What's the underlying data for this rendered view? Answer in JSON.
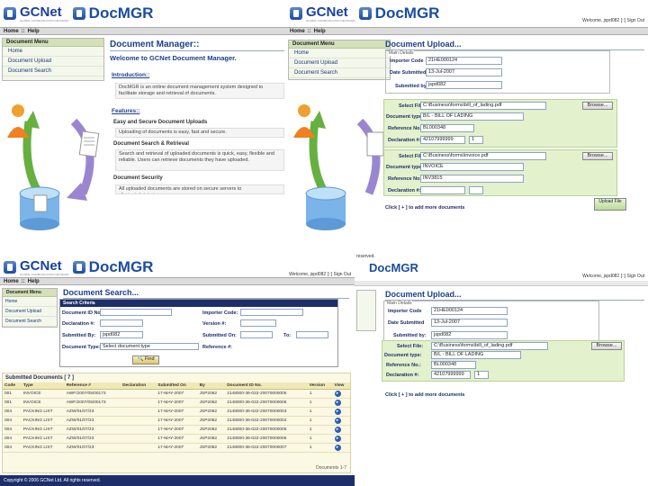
{
  "header": {
    "brand": "GCNet",
    "brand_sub": "GLOBAL COMMUNICATION NETWORK",
    "product": "DocMGR"
  },
  "nav": {
    "home": "Home",
    "sep": "::",
    "help": "Help"
  },
  "welcome_text": "Welcome, jspd082 [::] Sign Out",
  "sidebar": {
    "title": "Document Menu",
    "items": [
      "Home",
      "Document Upload",
      "Document Search"
    ]
  },
  "manager": {
    "title": "Document Manager::",
    "welcome": "Welcome to GCNet Document Manager.",
    "intro_heading": "Introduction::",
    "intro_text": "DocMGR is an online document management system designed to facilitate storage and retrieval of documents.",
    "features_heading": "Features::",
    "f1_title": "Easy and Secure Document Uploads",
    "f1_text": "Uploading of documents is easy, fast and secure.",
    "f2_title": "Document Search & Retrieval",
    "f2_text": "Search and retrieval of uploaded documents is quick, easy, flexible and reliable. Users can retrieve documents they have uploaded.",
    "f3_title": "Document Security",
    "f3_text": "All uploaded documents are stored on secure servers to eliminate/minimize"
  },
  "upload1": {
    "title": "Document Upload...",
    "main_details": "Main Details",
    "importer_code_label": "Importer Code",
    "importer_code": "21HE000124",
    "date_submitted_label": "Date Submitted",
    "date_submitted": "13-Jul-2007",
    "submitted_by_label": "Submitted by:",
    "submitted_by": "jspd082",
    "select_file_label": "Select File:",
    "file1": "C:\\Business\\forms\\bill_of_lading.pdf",
    "browse": "Browse...",
    "doc_type_label": "Document type:",
    "doc_type1": "B/L - BILL OF LADING",
    "ref_no_label": "Reference No.:",
    "ref1": "BL000348",
    "decl_label": "Declaration #:",
    "decl1": "42107999999",
    "decl1_seq": "1",
    "file2": "C:\\Business\\forms\\invoice.pdf",
    "doc_type2": "INVOICE",
    "ref2": "INV3815",
    "decl2": "",
    "add_more": "Click [ + ] to add more documents",
    "upload_btn": "Upload File"
  },
  "search": {
    "title": "Document Search...",
    "criteria": "Search Criteria",
    "doc_id_label": "Document ID No.:",
    "importer_label": "Importer Code:",
    "decl_label": "Declaration #:",
    "version_label": "Version #:",
    "submitted_by_label": "Submitted By:",
    "submitted_by": "jspd082",
    "submitted_on_label": "Submitted On:",
    "to_label": "To:",
    "doc_type_label": "Document Type:",
    "doc_type": "Select document type",
    "ref_label": "Reference #:",
    "find_btn": "Find",
    "results_title": "Submitted Documents",
    "results_count": "[ 7 ]",
    "columns": [
      "Code",
      "Type",
      "Reference #",
      "Declaration",
      "Submitted On",
      "By",
      "Document ID No.",
      "Version",
      "View"
    ],
    "rows": [
      [
        "001",
        "INVOICE",
        "AWF/2007/05/00173",
        "",
        "17-MAY-2007",
        "JSP2062",
        "2148000-36-022-20070000005",
        "1"
      ],
      [
        "001",
        "INVOICE",
        "AWF/2007/05/00173",
        "",
        "17-MAY-2007",
        "JSP2062",
        "2148000-36-022-20070000006",
        "1"
      ],
      [
        "004",
        "PACKING LIST",
        "AZW/01/07/23",
        "",
        "17-MAY-2007",
        "JSP2062",
        "2148000-36-022-20070000003",
        "1"
      ],
      [
        "004",
        "PACKING LIST",
        "AZW/01/07/23",
        "",
        "17-MAY-2007",
        "JSP2062",
        "2148000-36-022-20070000004",
        "1"
      ],
      [
        "004",
        "PACKING LIST",
        "AZW/01/07/23",
        "",
        "17-MAY-2007",
        "JSP2062",
        "2148000-36-022-20070000005",
        "1"
      ],
      [
        "004",
        "PACKING LIST",
        "AZW/01/07/23",
        "",
        "17-MAY-2007",
        "JSP2062",
        "2148000-36-022-20070000006",
        "1"
      ],
      [
        "004",
        "PACKING LIST",
        "AZW/01/07/23",
        "",
        "17-MAY-2007",
        "JSP2062",
        "2148000-36-022-20070000007",
        "1"
      ]
    ],
    "pager": "Documents 1-7",
    "copyright": "Copyright © 2006 GCNet Ltd. All rights reserved."
  },
  "upload2": {
    "reserved": "reserved.",
    "title": "Document Upload...",
    "main_details": "Main Details",
    "importer_code_label": "Importer Code",
    "importer_code": "21HE000124",
    "date_submitted_label": "Date Submitted",
    "date_submitted": "13-Jul-2007",
    "submitted_by_label": "Submitted by:",
    "submitted_by": "jspd082",
    "select_file_label": "Select File:",
    "file1": "C:\\Business\\forms\\bill_of_lading.pdf",
    "browse": "Browse...",
    "doc_type_label": "Document type:",
    "doc_type1": "B/L - BILL OF LADING",
    "ref_no_label": "Reference No.:",
    "ref1": "BL000348",
    "decl_label": "Declaration #:",
    "decl1": "42107999999",
    "decl1_seq": "1",
    "add_more": "Click [ + ] to add more documents",
    "welcome": "Welcome, jspd082 [::] Sign Out"
  }
}
